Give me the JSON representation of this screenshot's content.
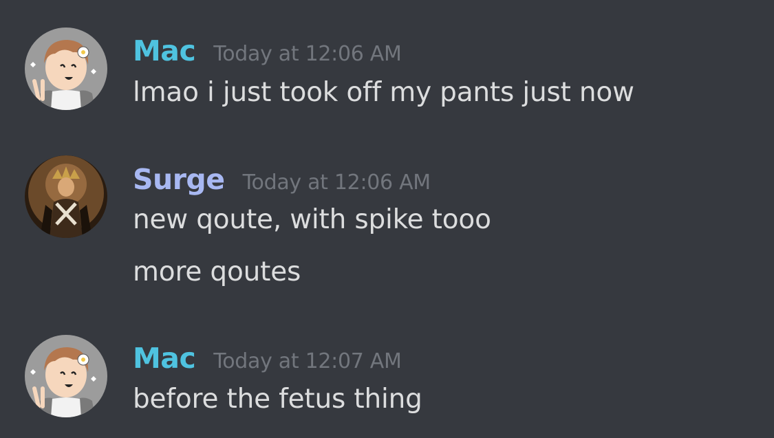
{
  "colors": {
    "background": "#36393f",
    "mac_name": "#4fc3e0",
    "surge_name": "#a8b8f2",
    "timestamp": "#72767d",
    "message_text": "#dcddde"
  },
  "messages": [
    {
      "username": "Mac",
      "timestamp": "Today at 12:06 AM",
      "avatar_icon": "cartoon-boy-avatar-icon",
      "lines": [
        "lmao i just took off my pants just now"
      ]
    },
    {
      "username": "Surge",
      "timestamp": "Today at 12:06 AM",
      "avatar_icon": "warrior-king-avatar-icon",
      "lines": [
        "new qoute, with spike tooo",
        "more qoutes"
      ]
    },
    {
      "username": "Mac",
      "timestamp": "Today at 12:07 AM",
      "avatar_icon": "cartoon-boy-avatar-icon",
      "lines": [
        "before the fetus thing"
      ]
    }
  ]
}
